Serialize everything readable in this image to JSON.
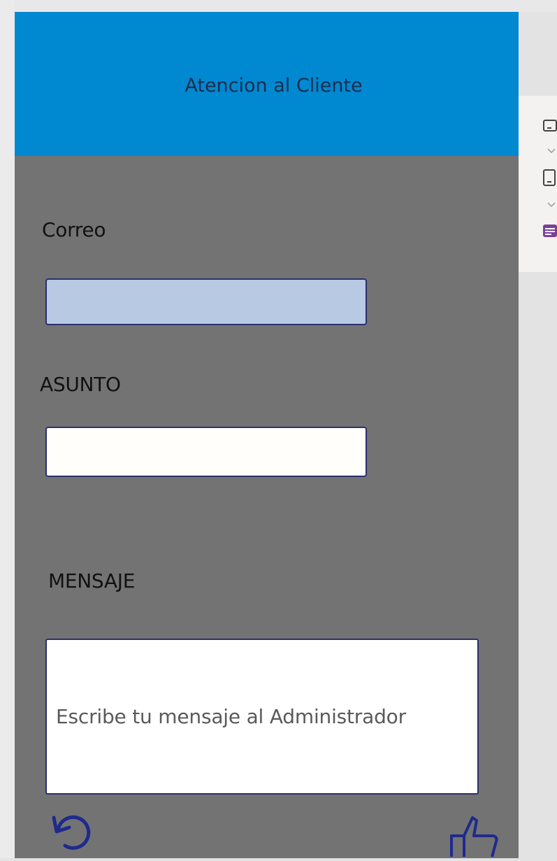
{
  "header": {
    "title": "Atencion al Cliente"
  },
  "form": {
    "email_label": "Correo",
    "email_value": "",
    "subject_label": "ASUNTO",
    "subject_value": "",
    "message_label": "MENSAJE",
    "message_placeholder": "Escribe tu mensaje al Administrador"
  },
  "icons": {
    "reset": "undo-icon",
    "send": "thumbs-up-icon",
    "panel": [
      "screen-icon",
      "chevron-down-icon",
      "screen-icon",
      "chevron-down-icon",
      "table-icon"
    ]
  },
  "colors": {
    "header_bg": "#0088d1",
    "body_bg": "#737373",
    "input_border": "#2a2f6e",
    "email_bg": "#b8c9e3"
  }
}
